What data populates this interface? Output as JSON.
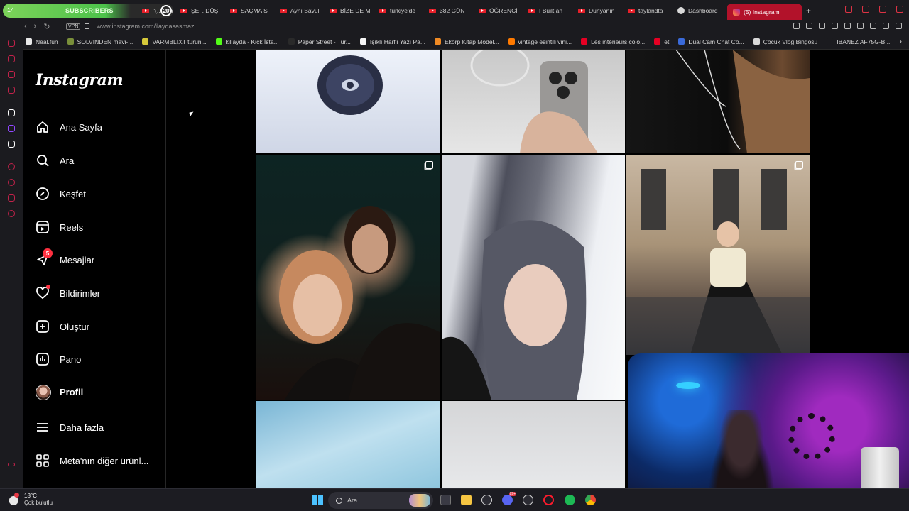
{
  "browser": {
    "subscribers_pill": {
      "lead": "14",
      "label": "SUBSCRIBERS",
      "count": "20"
    },
    "tabs": [
      {
        "label": "\"(...) Pa",
        "kind": "youtube"
      },
      {
        "label": "ŞEF, DÜŞ",
        "kind": "youtube"
      },
      {
        "label": "SAÇMA S",
        "kind": "youtube"
      },
      {
        "label": "Aynı Bavul",
        "kind": "youtube"
      },
      {
        "label": "BİZE DE M",
        "kind": "youtube"
      },
      {
        "label": "türkiye'de",
        "kind": "youtube"
      },
      {
        "label": "382 GÜN",
        "kind": "youtube"
      },
      {
        "label": "ÖĞRENCİ",
        "kind": "youtube"
      },
      {
        "label": "I Built an",
        "kind": "youtube"
      },
      {
        "label": "Dünyanın",
        "kind": "youtube"
      },
      {
        "label": "taylandta",
        "kind": "youtube"
      },
      {
        "label": "Dashboard",
        "kind": "dashboard"
      },
      {
        "label": "(5) Instagram",
        "kind": "instagram",
        "active": true
      }
    ],
    "new_tab_label": "+",
    "address": {
      "vpn": "VPN",
      "url": "www.instagram.com/ilaydasasmaz"
    },
    "bookmarks": [
      {
        "label": "Neal.fun",
        "color": "#e8e8e8"
      },
      {
        "label": "SOLVINDEN mavi-...",
        "color": "#7a8f3a"
      },
      {
        "label": "VARMBLIXT turun...",
        "color": "#d6c93a"
      },
      {
        "label": "killayda - Kick İsta...",
        "color": "#53fc18"
      },
      {
        "label": "Paper Street - Tur...",
        "color": "#2a2a2a"
      },
      {
        "label": "Işıklı Harfli Yazı Pa...",
        "color": "#f5f5f5"
      },
      {
        "label": "Ekorp Kitap Model...",
        "color": "#f08a24"
      },
      {
        "label": "vintage esintili vini...",
        "color": "#ff7a00"
      },
      {
        "label": "Les intérieurs colo...",
        "color": "#e60023"
      },
      {
        "label": "et",
        "color": "#e60023"
      },
      {
        "label": "Dual Cam Chat Co...",
        "color": "#3a6ad9"
      },
      {
        "label": "Çocuk Vlog Bingosu",
        "color": "#d9d9d9"
      },
      {
        "label": "IBANEZ AF75G-B...",
        "color": "#1b1b1f"
      }
    ]
  },
  "instagram": {
    "logo": "Instagram",
    "nav": [
      {
        "key": "home",
        "label": "Ana Sayfa",
        "icon": "home-icon"
      },
      {
        "key": "search",
        "label": "Ara",
        "icon": "search-icon"
      },
      {
        "key": "explore",
        "label": "Keşfet",
        "icon": "compass-icon"
      },
      {
        "key": "reels",
        "label": "Reels",
        "icon": "reels-icon"
      },
      {
        "key": "messages",
        "label": "Mesajlar",
        "icon": "messenger-icon",
        "badge": "5"
      },
      {
        "key": "notifications",
        "label": "Bildirimler",
        "icon": "heart-icon",
        "dot": true
      },
      {
        "key": "create",
        "label": "Oluştur",
        "icon": "plus-square-icon"
      },
      {
        "key": "dashboard",
        "label": "Pano",
        "icon": "chart-icon"
      },
      {
        "key": "profile",
        "label": "Profil",
        "icon": "avatar",
        "bold": true
      },
      {
        "key": "more",
        "label": "Daha fazla",
        "icon": "hamburger-icon"
      },
      {
        "key": "meta",
        "label": "Meta'nın diğer ürünl...",
        "icon": "grid-icon"
      }
    ]
  },
  "taskbar": {
    "weather": {
      "temp": "18°C",
      "condition": "Çok bulutlu"
    },
    "search_placeholder": "Ara"
  },
  "colors": {
    "accent_red": "#b2122a",
    "notification": "#ff3040",
    "bg": "#000000"
  }
}
